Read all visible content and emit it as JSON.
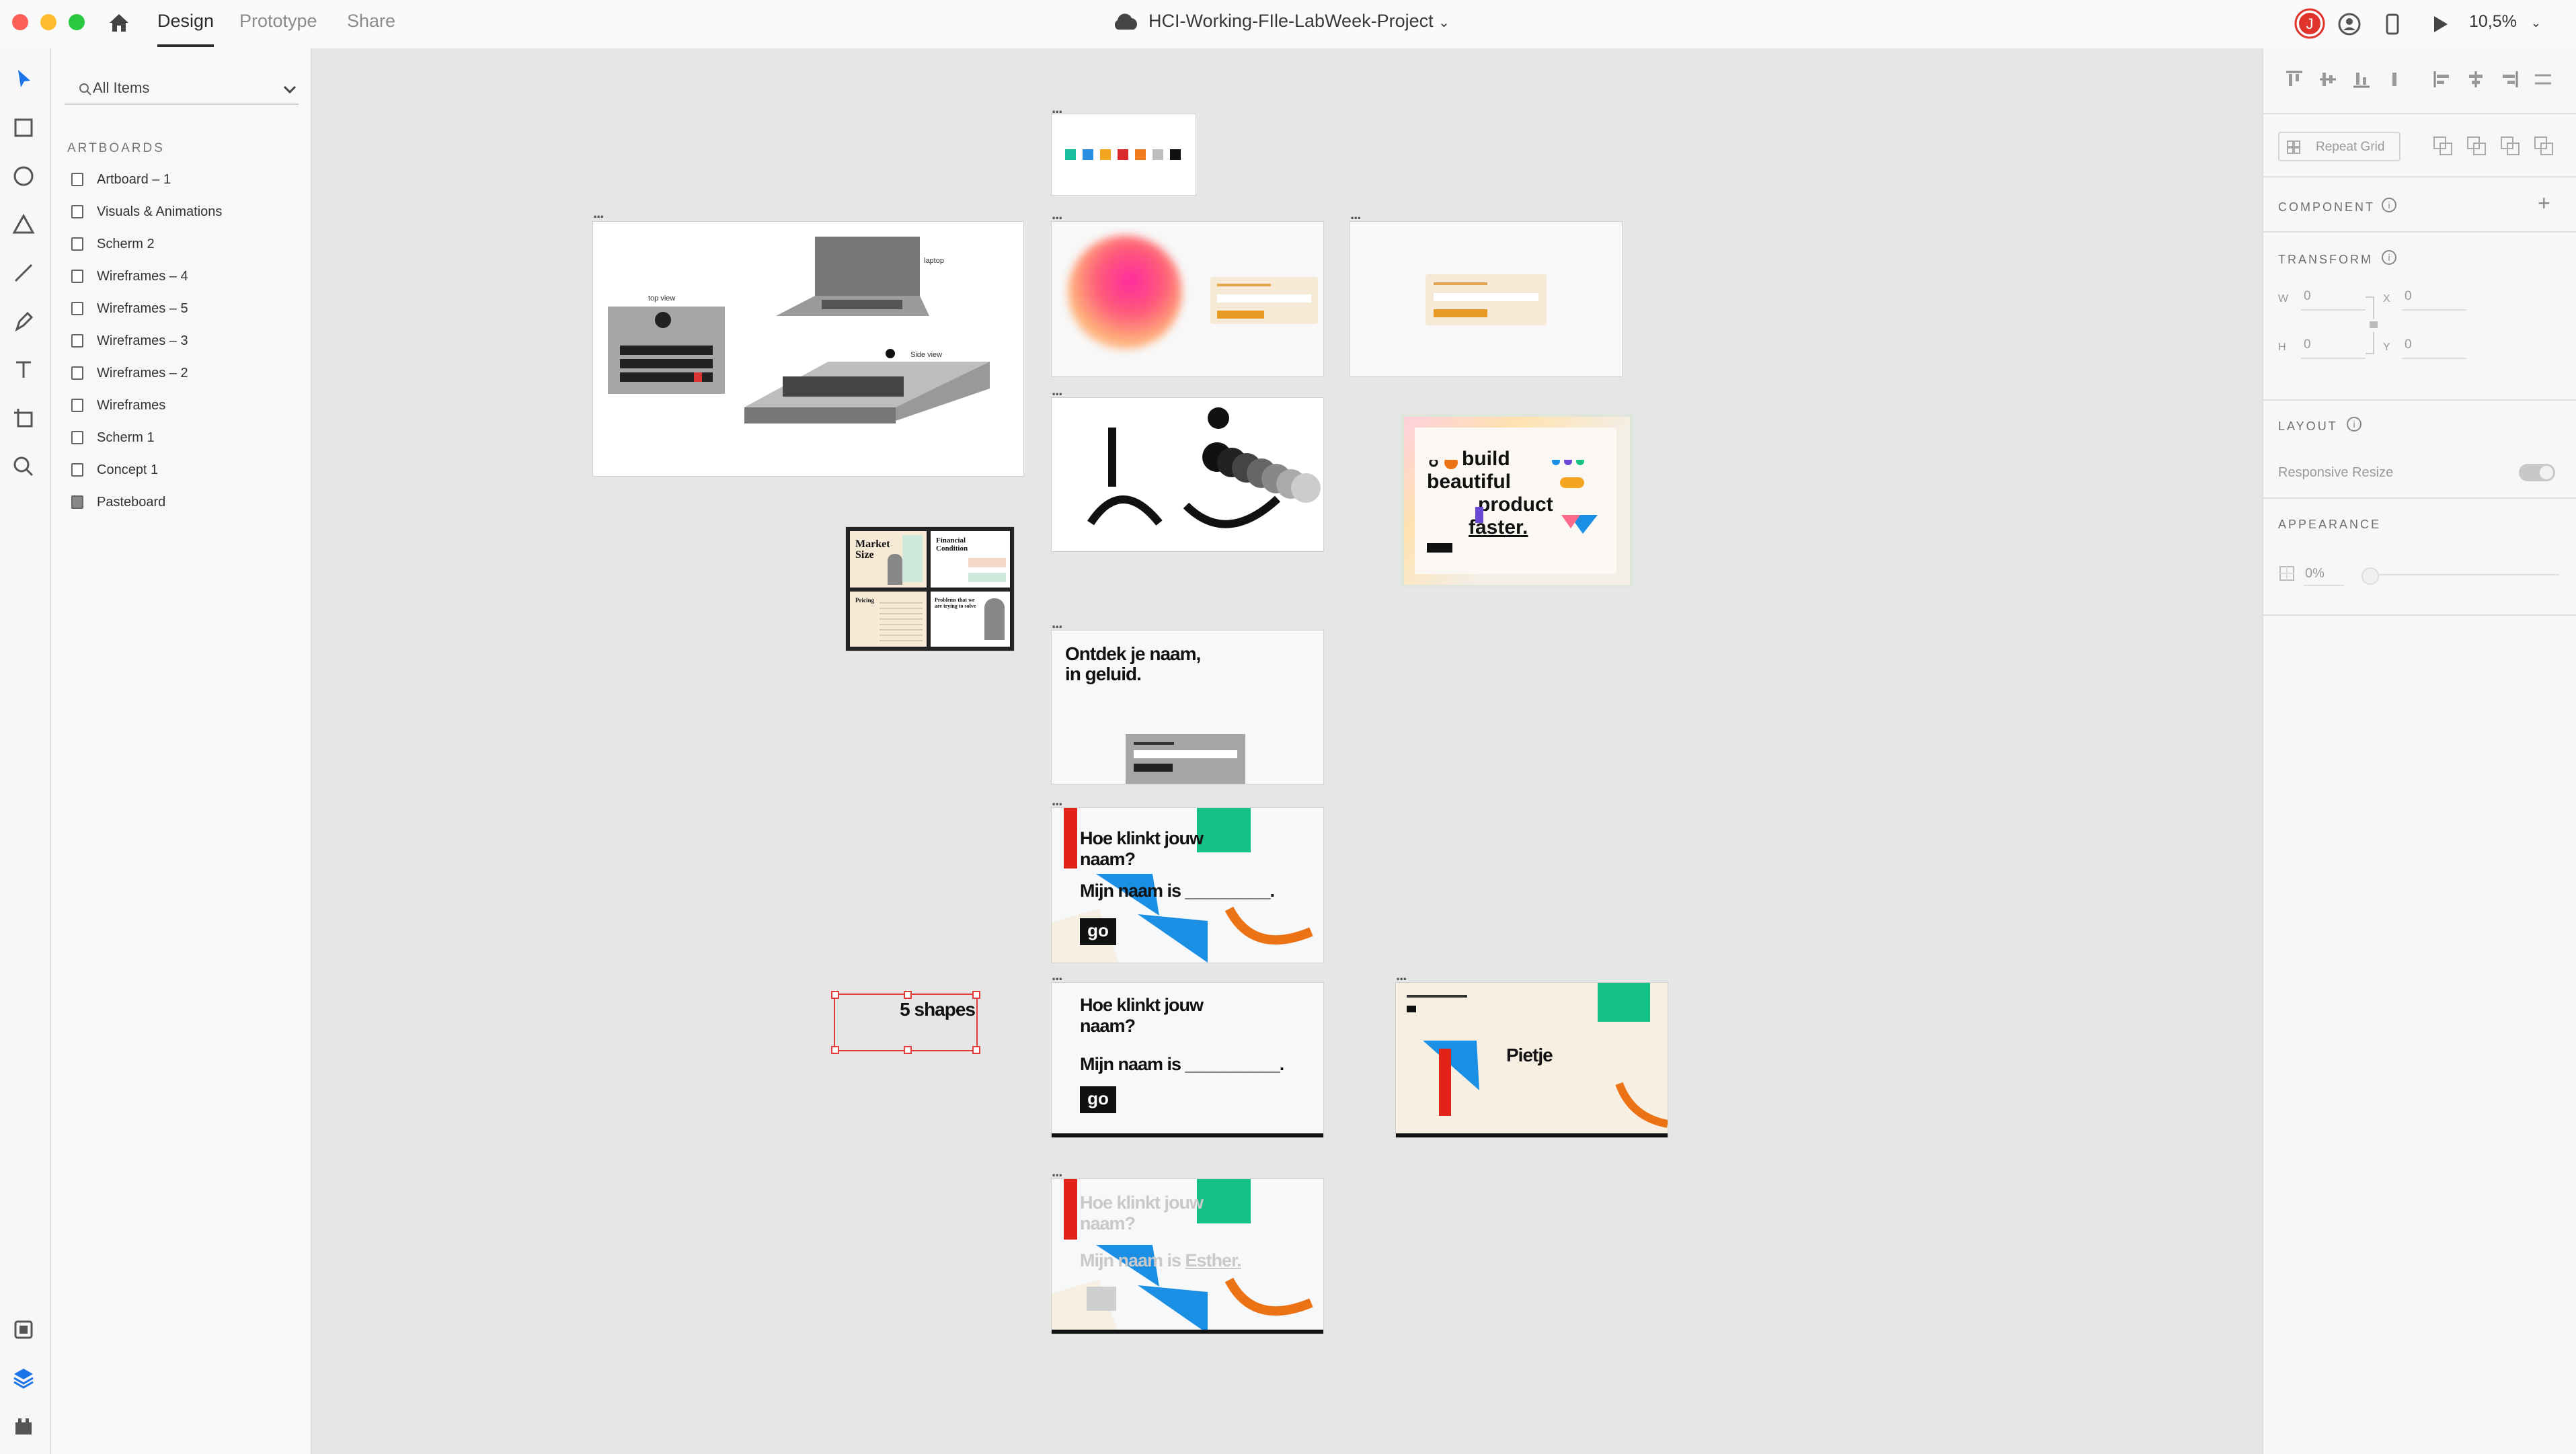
{
  "topbar": {
    "tabs": [
      "Design",
      "Prototype",
      "Share"
    ],
    "document_title": "HCI-Working-FIle-LabWeek-Project",
    "zoom": "10,5%",
    "avatar_initial": "J"
  },
  "leftpanel": {
    "search_placeholder": "All Items",
    "section_title": "ARTBOARDS",
    "items": [
      "Artboard – 1",
      "Visuals & Animations",
      "Scherm 2",
      "Wireframes – 4",
      "Wireframes – 5",
      "Wireframes – 3",
      "Wireframes – 2",
      "Wireframes",
      "Scherm 1",
      "Concept 1",
      "Pasteboard"
    ]
  },
  "rightpanel": {
    "repeat_grid": "Repeat Grid",
    "component": "COMPONENT",
    "transform": "TRANSFORM",
    "w_label": "W",
    "w_value": "0",
    "h_label": "H",
    "h_value": "0",
    "x_label": "X",
    "x_value": "0",
    "y_label": "Y",
    "y_value": "0",
    "layout": "LAYOUT",
    "responsive_resize": "Responsive Resize",
    "appearance": "APPEARANCE",
    "opacity": "0%"
  },
  "canvas": {
    "laptop_labels": {
      "laptop": "laptop",
      "top_view": "top view",
      "side_view": "Side view"
    },
    "ontdek_title": "Ontdek je naam,\nin geluid.",
    "question": "Hoe klinkt jouw\nnaam?",
    "mijn_naam": "Mijn naam is _________.",
    "mijn_naam_long": "Mijn naam is __________.",
    "mijn_naam_esther_prefix": "Mijn naam is ",
    "esther": "Esther.",
    "go": "go",
    "pietje": "Pietje",
    "five_shapes": "5 shapes",
    "build_lines": [
      "build",
      "beautiful",
      "product",
      "faster."
    ],
    "market_size": "Market Size",
    "financial": "Financial Condition",
    "pricing": "Pricing",
    "problems": "Problems that we are trying to solve",
    "swatch_colors": [
      "#1bbfa0",
      "#2a8fe0",
      "#f4a623",
      "#d92b2b",
      "#f07b21",
      "#bdbdbd",
      "#111111"
    ],
    "brand_colors": {
      "red": "#e2231a",
      "green": "#15c185",
      "blue": "#1a8fe3",
      "orange": "#ec7216",
      "cream": "#f7efe2"
    }
  }
}
